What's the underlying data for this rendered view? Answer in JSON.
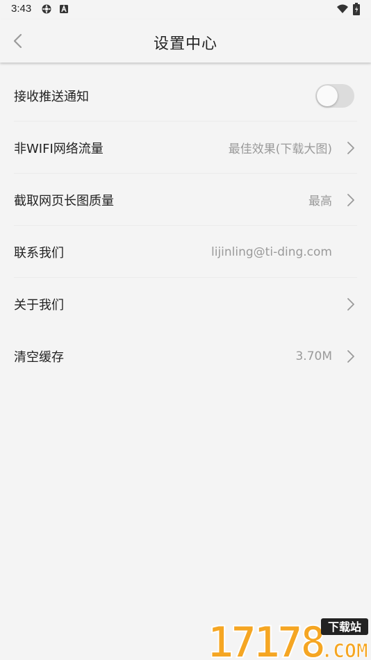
{
  "status_bar": {
    "time": "3:43",
    "icons": [
      "settings-gear-icon",
      "a-icon",
      "wifi-icon",
      "battery-icon"
    ]
  },
  "header": {
    "back_icon": "chevron-left-icon",
    "title": "设置中心"
  },
  "settings": {
    "push": {
      "label": "接收推送通知",
      "toggle_on": false
    },
    "non_wifi": {
      "label": "非WIFI网络流量",
      "value": "最佳效果(下载大图)"
    },
    "screenshot_quality": {
      "label": "截取网页长图质量",
      "value": "最高"
    },
    "contact": {
      "label": "联系我们",
      "value": "lijinling@ti-ding.com"
    },
    "about": {
      "label": "关于我们"
    },
    "cache": {
      "label": "清空缓存",
      "value": "3.70M"
    }
  },
  "watermark": {
    "number_text": "17178",
    "badge_text": "下载站",
    "com_text": ".COM"
  },
  "colors": {
    "background": "#f4f4f4",
    "text": "#222222",
    "secondary_text": "#9a9a9a",
    "divider": "#ebebeb",
    "toggle_off": "#dcdcdc",
    "watermark_orange": "#f5a623"
  }
}
